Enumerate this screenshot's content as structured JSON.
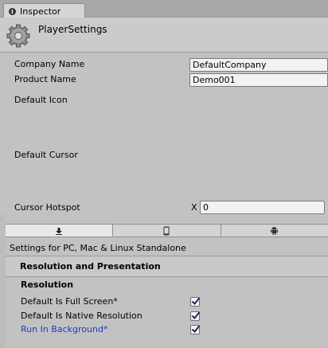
{
  "window": {
    "tab_label": "Inspector",
    "tab_icon": "info-icon"
  },
  "header": {
    "title": "PlayerSettings",
    "icon": "gear-icon"
  },
  "fields": {
    "company_name_label": "Company Name",
    "company_name_value": "DefaultCompany",
    "product_name_label": "Product Name",
    "product_name_value": "Demo001",
    "default_icon_label": "Default Icon",
    "default_cursor_label": "Default Cursor",
    "cursor_hotspot_label": "Cursor Hotspot",
    "cursor_hotspot_x_label": "X",
    "cursor_hotspot_x_value": "0"
  },
  "platforms": {
    "tabs": [
      {
        "name": "standalone",
        "icon": "download-arrow-icon",
        "active": true
      },
      {
        "name": "mobile",
        "icon": "phone-icon",
        "active": false
      },
      {
        "name": "android",
        "icon": "android-icon",
        "active": false
      }
    ],
    "settings_for": "Settings for PC, Mac & Linux Standalone"
  },
  "section": {
    "title": "Resolution and Presentation",
    "subsection_title": "Resolution",
    "options": [
      {
        "label": "Default Is Full Screen*",
        "checked": true,
        "modified": false
      },
      {
        "label": "Default Is Native Resolution",
        "checked": true,
        "modified": false
      },
      {
        "label": "Run In Background*",
        "checked": true,
        "modified": true
      }
    ]
  },
  "colors": {
    "modified_label": "#1a3fb8",
    "panel_bg": "#c2c2c2"
  }
}
